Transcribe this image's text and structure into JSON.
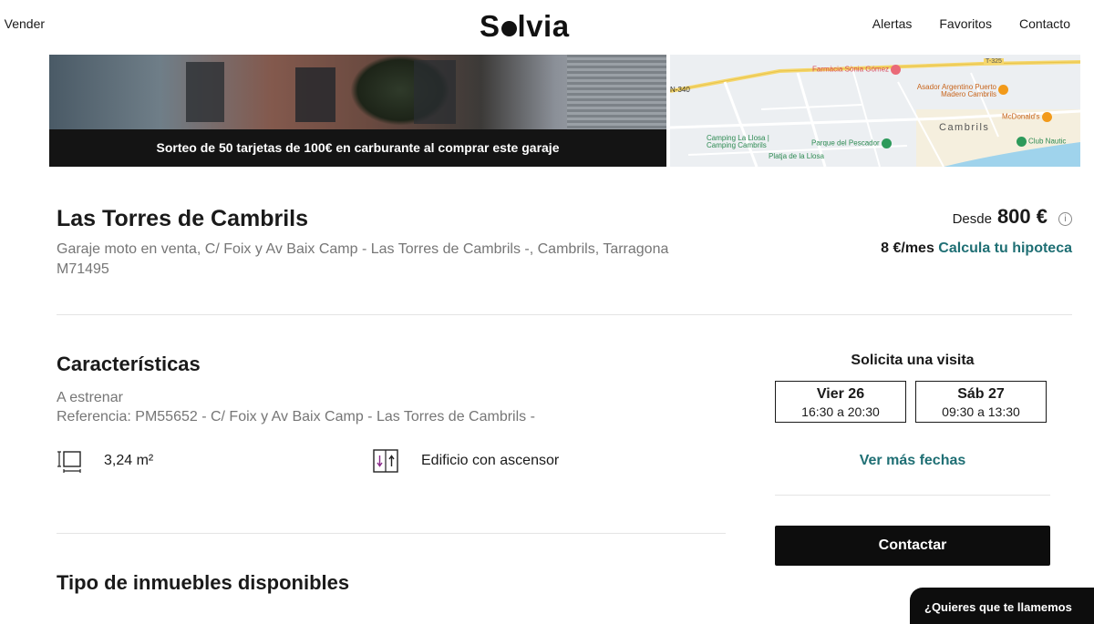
{
  "nav": {
    "left_link": "Vender",
    "logo": "Solvia",
    "right_links": [
      "Alertas",
      "Favoritos",
      "Contacto"
    ]
  },
  "media": {
    "photo_caption": "Sorteo de 50 tarjetas de 100€ en carburante al comprar este garaje",
    "map_labels": {
      "road_n340": "N-340",
      "road_t": "T-325",
      "pharmacy": "Farmàcia Sònia Gómez",
      "asador": "Asador Argentino Puerto Madero Cambrils",
      "mcdonalds": "McDonald's",
      "town": "Cambrils",
      "camping": "Camping La Llosa | Camping Cambrils",
      "parque": "Parque del Pescador",
      "club": "Club Nautic",
      "platja": "Platja de la Llosa"
    }
  },
  "listing": {
    "title": "Las Torres de Cambrils",
    "subtitle": "Garaje moto en venta, C/ Foix y Av Baix Camp - Las Torres de Cambrils -, Cambrils, Tarragona M71495",
    "price_prefix": "Desde",
    "price": "800 €",
    "info_symbol": "i",
    "monthly": "8 €/mes",
    "mortgage_link": "Calcula tu hipoteca"
  },
  "characteristics": {
    "heading": "Características",
    "condition": "A estrenar",
    "reference": "Referencia: PM55652 - C/ Foix y Av Baix Camp - Las Torres de Cambrils -",
    "features": [
      {
        "icon": "area-icon",
        "label": "3,24 m²"
      },
      {
        "icon": "elevator-icon",
        "label": "Edificio con ascensor"
      }
    ]
  },
  "visit": {
    "heading": "Solicita una visita",
    "dates": [
      {
        "day": "Vier 26",
        "hours": "16:30 a 20:30"
      },
      {
        "day": "Sáb 27",
        "hours": "09:30 a 13:30"
      }
    ],
    "more_dates": "Ver más fechas",
    "contact_button": "Contactar"
  },
  "available": {
    "heading": "Tipo de inmuebles disponibles"
  },
  "callback": {
    "label": "¿Quieres que te llamemos"
  },
  "colors": {
    "accent_teal": "#1f6f74",
    "button_black": "#0d0d0d",
    "muted_text": "#767676"
  }
}
